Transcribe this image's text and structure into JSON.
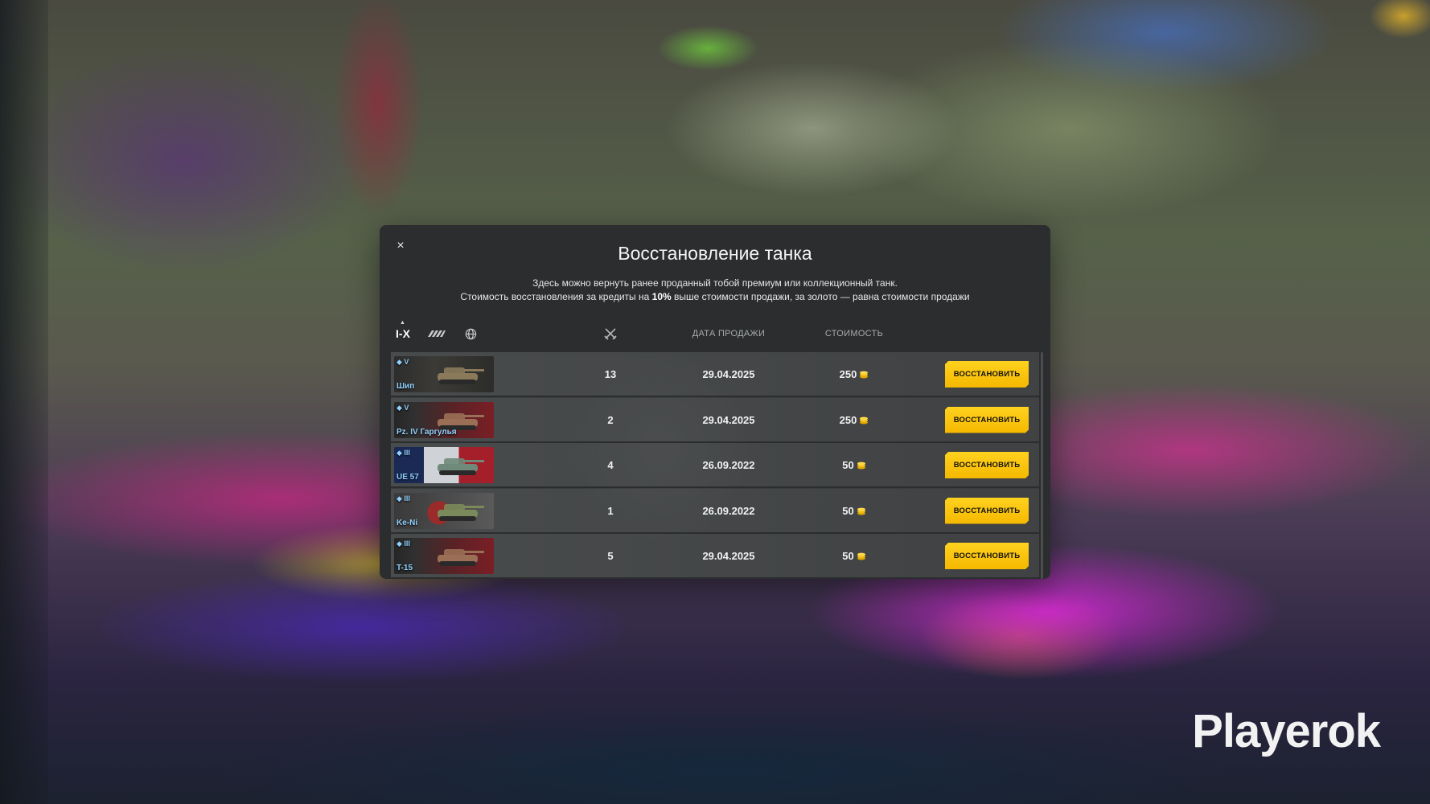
{
  "dialog": {
    "title": "Восстановление танка",
    "close_icon": "×",
    "description_line1": "Здесь можно вернуть ранее проданный тобой премиум или коллекционный танк.",
    "description_line2_before": "Стоимость восстановления за кредиты на ",
    "description_line2_bold": "10%",
    "description_line2_after": " выше стоимости продажи, за золото — равна стоимости продажи"
  },
  "header": {
    "filter_tier_label": "I-X",
    "filter_type_icon": "vehicle-type-icon",
    "filter_nation_icon": "globe-icon",
    "battles_icon": "crossed-swords-icon",
    "date_label": "ДАТА ПРОДАЖИ",
    "cost_label": "СТОИМОСТЬ"
  },
  "rows": [
    {
      "tier": "V",
      "name": "Шип",
      "battles": "13",
      "date": "29.04.2025",
      "cost": "250",
      "button": "ВОССТАНОВИТЬ",
      "flag": "ussr"
    },
    {
      "tier": "V",
      "name": "Pz. IV Гаргулья",
      "battles": "2",
      "date": "29.04.2025",
      "cost": "250",
      "button": "ВОССТАНОВИТЬ",
      "flag": "germany"
    },
    {
      "tier": "III",
      "name": "UE 57",
      "battles": "4",
      "date": "26.09.2022",
      "cost": "50",
      "button": "ВОССТАНОВИТЬ",
      "flag": "france"
    },
    {
      "tier": "III",
      "name": "Ke-Ni",
      "battles": "1",
      "date": "26.09.2022",
      "cost": "50",
      "button": "ВОССТАНОВИТЬ",
      "flag": "japan"
    },
    {
      "tier": "III",
      "name": "T-15",
      "battles": "5",
      "date": "29.04.2025",
      "cost": "50",
      "button": "ВОССТАНОВИТЬ",
      "flag": "germany"
    }
  ],
  "watermark": "Playerok",
  "colors": {
    "accent_button": "#ffd21f",
    "dialog_bg": "#2b2d2e",
    "tank_name": "#8fd0ff"
  }
}
